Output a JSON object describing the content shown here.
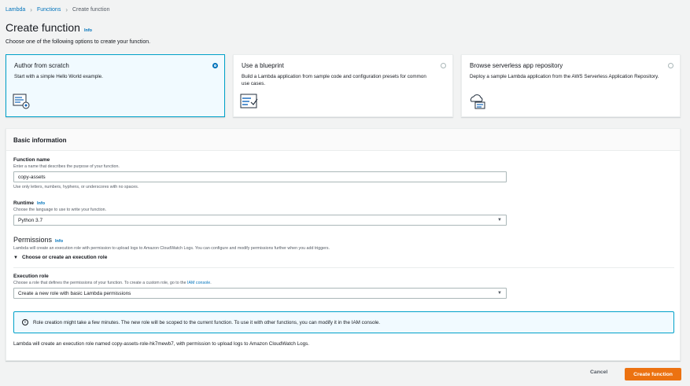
{
  "breadcrumb": {
    "items": [
      "Lambda",
      "Functions"
    ],
    "current": "Create function"
  },
  "header": {
    "title": "Create function",
    "info": "Info",
    "subtitle": "Choose one of the following options to create your function."
  },
  "options": [
    {
      "title": "Author from scratch",
      "desc": "Start with a simple Hello World example.",
      "icon": "code-editor-icon",
      "selected": true
    },
    {
      "title": "Use a blueprint",
      "desc": "Build a Lambda application from sample code and configuration presets for common use cases.",
      "icon": "blueprint-icon",
      "selected": false
    },
    {
      "title": "Browse serverless app repository",
      "desc": "Deploy a sample Lambda application from the AWS Serverless Application Repository.",
      "icon": "cloud-repository-icon",
      "selected": false
    }
  ],
  "basic": {
    "heading": "Basic information",
    "function_name": {
      "label": "Function name",
      "desc": "Enter a name that describes the purpose of your function.",
      "value": "copy-assets",
      "hint": "Use only letters, numbers, hyphens, or underscores with no spaces."
    },
    "runtime": {
      "label": "Runtime",
      "info": "Info",
      "desc": "Choose the language to use to write your function.",
      "value": "Python 3.7"
    },
    "permissions": {
      "title": "Permissions",
      "info": "Info",
      "desc": "Lambda will create an execution role with permission to upload logs to Amazon CloudWatch Logs. You can configure and modify permissions further when you add triggers.",
      "expander": "Choose or create an execution role"
    },
    "execution_role": {
      "label": "Execution role",
      "desc_prefix": "Choose a role that defines the permissions of your function. To create a custom role, go to the",
      "desc_link": "IAM console",
      "desc_suffix": ".",
      "value": "Create a new role with basic Lambda permissions"
    },
    "alert": "Role creation might take a few minutes. The new role will be scoped to the current function. To use it with other functions, you can modify it in the IAM console.",
    "footnote": "Lambda will create an execution role named copy-assets-role-hk7mewb7, with permission to upload logs to Amazon CloudWatch Logs."
  },
  "actions": {
    "cancel": "Cancel",
    "create": "Create function"
  },
  "colors": {
    "accent": "#0073bb",
    "primary_button": "#ec7211",
    "selected_card": "#f1faff"
  }
}
